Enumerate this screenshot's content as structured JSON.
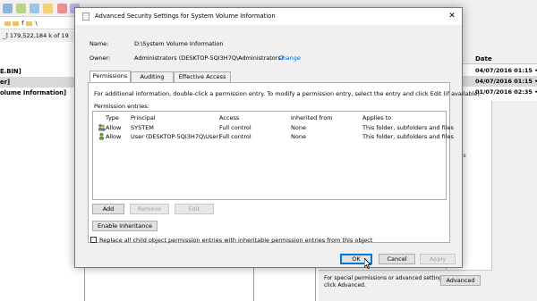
{
  "background": {
    "path_text": "f",
    "path_text2": "\\",
    "free_space": "_]  179,522,184 k of 19",
    "left_rows": [
      {
        "label": "E.BIN]",
        "selected": false
      },
      {
        "label": "er]",
        "selected": true
      },
      {
        "label": "olume Information]",
        "selected": false
      }
    ],
    "date_header": "Date",
    "dates": [
      {
        "label": "04/07/2016 01:15 •",
        "selected": false
      },
      {
        "label": "04/07/2016 01:15 •",
        "selected": true
      },
      {
        "label": "01/07/2016 02:35 •",
        "selected": false
      }
    ],
    "right_panel_lines": [
      "e",
      "",
      "",
      "",
      "to",
      "of this"
    ],
    "bottom_text_1": "For special permissions or advanced settings,",
    "bottom_text_2": "click Advanced.",
    "advanced_button": "Advanced"
  },
  "dialog": {
    "title": "Advanced Security Settings for System Volume Information",
    "name_label": "Name:",
    "name_value": "D:\\System Volume Information",
    "owner_label": "Owner:",
    "owner_value": "Administrators (DESKTOP-5QI3H7Q\\Administrators)",
    "owner_change": "Change",
    "tabs": [
      "Permissions",
      "Auditing",
      "Effective Access"
    ],
    "active_tab": "Permissions",
    "description": "For additional information, double-click a permission entry. To modify a permission entry, select the entry and click Edit (if available).",
    "entries_label": "Permission entries:",
    "columns": [
      "Type",
      "Principal",
      "Access",
      "Inherited from",
      "Applies to"
    ],
    "rows": [
      {
        "type": "Allow",
        "principal": "SYSTEM",
        "access": "Full control",
        "inherited": "None",
        "applies": "This folder, subfolders and files"
      },
      {
        "type": "Allow",
        "principal": "User (DESKTOP-5QI3H7Q\\User)",
        "access": "Full control",
        "inherited": "None",
        "applies": "This folder, subfolders and files"
      }
    ],
    "buttons": {
      "add": "Add",
      "remove": "Remove",
      "edit": "Edit",
      "enable_inheritance": "Enable inheritance",
      "ok": "OK",
      "cancel": "Cancel",
      "apply": "Apply"
    },
    "replace_checkbox_label": "Replace all child object permission entries with inheritable permission entries from this object",
    "replace_checked": false
  },
  "colors": {
    "link": "#0066cc",
    "primary_border": "#0078d7",
    "dialog_bg": "#f0f0f0"
  }
}
